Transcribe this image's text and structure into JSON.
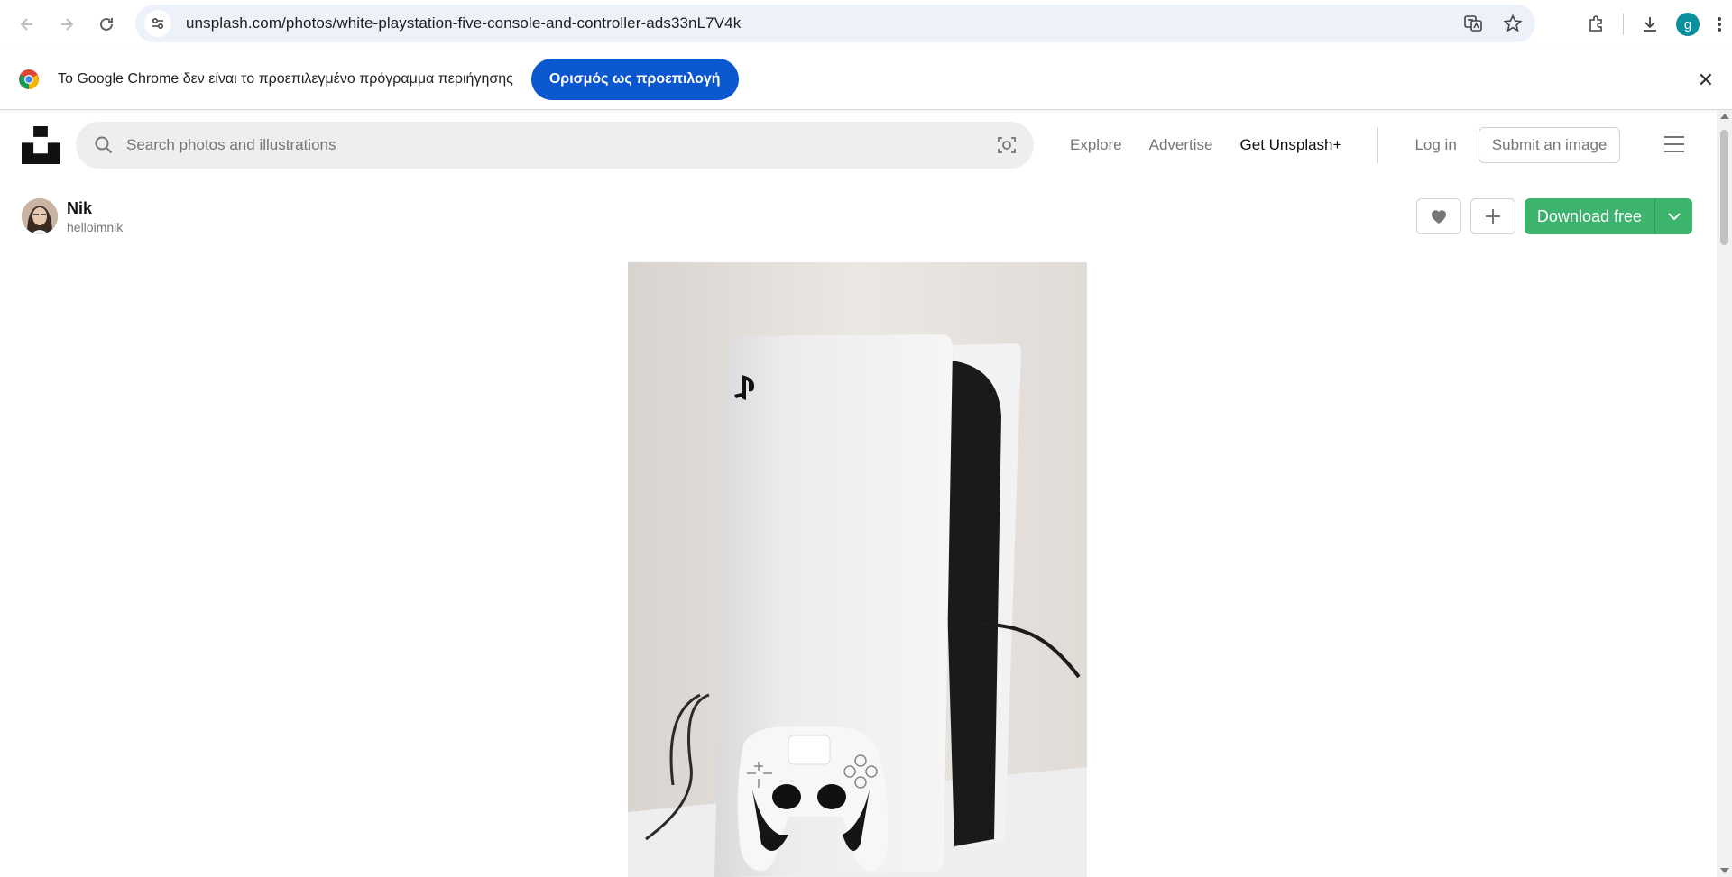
{
  "browser": {
    "url": "unsplash.com/photos/white-playstation-five-console-and-controller-ads33nL7V4k",
    "profile_initial": "g",
    "profile_color": "#0b8e9e"
  },
  "infobar": {
    "message": "Το Google Chrome δεν είναι το προεπιλεγμένο πρόγραμμα περιήγησης",
    "button_label": "Ορισμός ως προεπιλογή",
    "button_color": "#0b57d0"
  },
  "header": {
    "search_placeholder": "Search photos and illustrations",
    "nav": {
      "explore": "Explore",
      "advertise": "Advertise",
      "get_plus": "Get Unsplash+"
    },
    "login": "Log in",
    "submit": "Submit an image"
  },
  "photo": {
    "author_name": "Nik",
    "author_handle": "helloimnik",
    "download_label": "Download free",
    "download_color": "#3cb46e",
    "alt": "white playstation five console and controller"
  }
}
